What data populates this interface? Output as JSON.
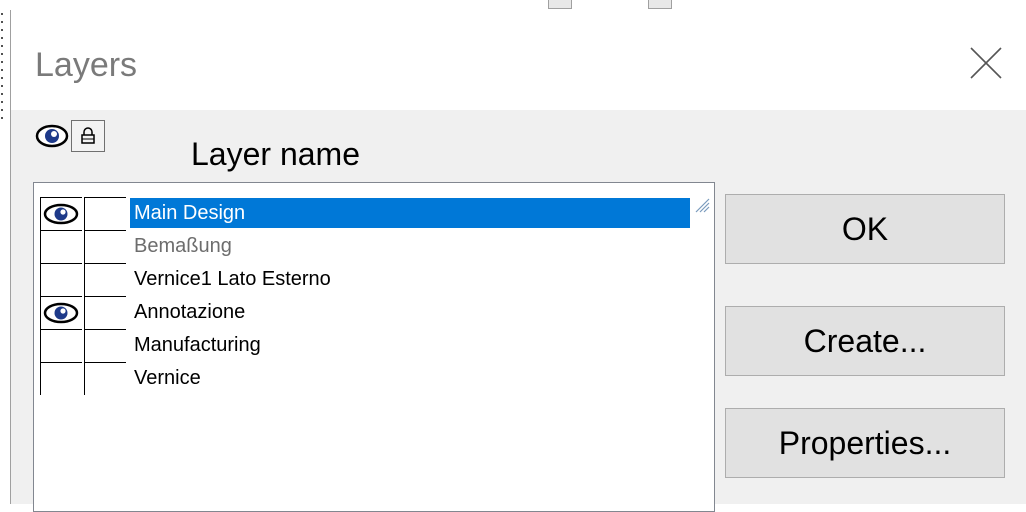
{
  "dialog": {
    "title": "Layers",
    "header": {
      "visibility_icon": "eye-icon",
      "lock_icon": "lock-icon",
      "column_label": "Layer name"
    },
    "layers": [
      {
        "name": "Main Design",
        "visible": true,
        "locked": false,
        "selected": true,
        "dimmed": false
      },
      {
        "name": "Bemaßung",
        "visible": false,
        "locked": false,
        "selected": false,
        "dimmed": true
      },
      {
        "name": "Vernice1 Lato Esterno",
        "visible": false,
        "locked": false,
        "selected": false,
        "dimmed": false
      },
      {
        "name": "Annotazione",
        "visible": true,
        "locked": false,
        "selected": false,
        "dimmed": false
      },
      {
        "name": "Manufacturing",
        "visible": false,
        "locked": false,
        "selected": false,
        "dimmed": false
      },
      {
        "name": "Vernice",
        "visible": false,
        "locked": false,
        "selected": false,
        "dimmed": false
      }
    ],
    "buttons": {
      "ok": "OK",
      "create": "Create...",
      "properties": "Properties..."
    },
    "close_icon": "close-icon"
  },
  "colors": {
    "selection": "#0078d7",
    "dialog_bg": "#f0f0f0",
    "button_bg": "#e1e1e1"
  }
}
